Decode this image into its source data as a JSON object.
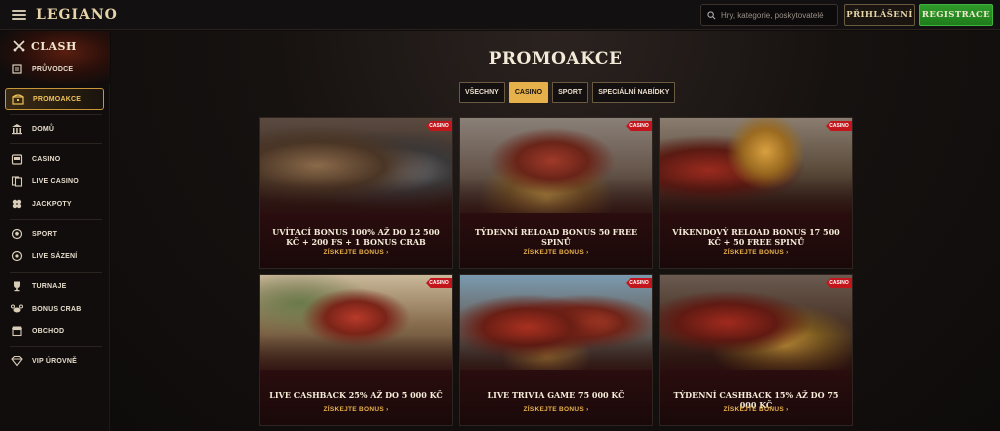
{
  "header": {
    "logo": "LEGIANO",
    "search_placeholder": "Hry, kategorie, poskytovatelé",
    "login_label": "PŘIHLÁŠENÍ",
    "register_label": "REGISTRACE"
  },
  "sidebar": {
    "clash_label": "CLASH",
    "items": [
      {
        "label": "PRŮVODCE",
        "icon": "scroll-icon"
      },
      {
        "label": "PROMOAKCE",
        "icon": "treasure-chest-icon",
        "active": true
      },
      {
        "label": "DOMŮ",
        "icon": "temple-icon"
      },
      {
        "label": "CASINO",
        "icon": "slot-machine-icon"
      },
      {
        "label": "LIVE CASINO",
        "icon": "cards-icon"
      },
      {
        "label": "JACKPOTY",
        "icon": "clover-icon"
      },
      {
        "label": "SPORT",
        "icon": "ball-icon"
      },
      {
        "label": "LIVE SÁZENÍ",
        "icon": "live-bet-icon"
      },
      {
        "label": "TURNAJE",
        "icon": "trophy-icon"
      },
      {
        "label": "BONUS CRAB",
        "icon": "crab-icon"
      },
      {
        "label": "OBCHOD",
        "icon": "shop-icon"
      },
      {
        "label": "VIP ÚROVNĚ",
        "icon": "diamond-icon"
      }
    ]
  },
  "main": {
    "title": "PROMOAKCE",
    "filters": [
      {
        "label": "VŠECHNY",
        "active": false
      },
      {
        "label": "CASINO",
        "active": true
      },
      {
        "label": "SPORT",
        "active": false
      },
      {
        "label": "SPECIÁLNÍ NABÍDKY",
        "active": false
      }
    ],
    "cards": [
      {
        "tag": "CASINO",
        "title": "UVÍTACÍ BONUS 100% AŽ DO 12 500 KČ + 200 FS + 1 BONUS CRAB",
        "cta": "ZÍSKEJTE BONUS"
      },
      {
        "tag": "CASINO",
        "title": "TÝDENNÍ RELOAD BONUS 50 FREE SPINŮ",
        "cta": "ZÍSKEJTE BONUS"
      },
      {
        "tag": "CASINO",
        "title": "VÍKENDOVÝ RELOAD BONUS 17 500 KČ + 50 FREE SPINŮ",
        "cta": "ZÍSKEJTE BONUS"
      },
      {
        "tag": "CASINO",
        "title": "LIVE CASHBACK 25% AŽ DO 5 000 KČ",
        "cta": "ZÍSKEJTE BONUS"
      },
      {
        "tag": "CASINO",
        "title": "LIVE TRIVIA GAME 75 000 KČ",
        "cta": "ZÍSKEJTE BONUS"
      },
      {
        "tag": "CASINO",
        "title": "TÝDENNÍ CASHBACK 15% AŽ DO 75 000 KČ",
        "cta": "ZÍSKEJTE BONUS"
      }
    ]
  },
  "colors": {
    "accent_gold": "#e6b04a",
    "register_green": "#2f9a2a",
    "tag_red": "#c2161c",
    "card_body": "#2a0d0e"
  }
}
